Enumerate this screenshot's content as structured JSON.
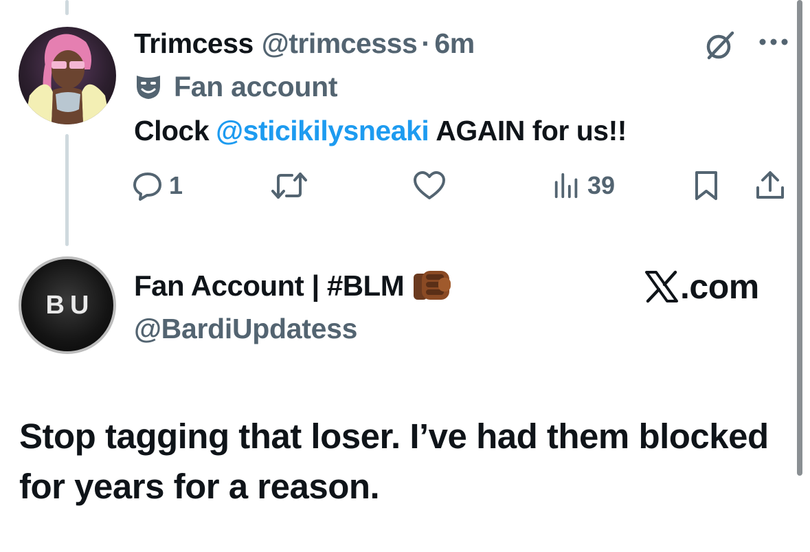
{
  "reply_tweet": {
    "author_name": "Trimcess",
    "author_handle": "@trimcesss",
    "separator": "·",
    "time": "6m",
    "label": "Fan account",
    "label_icon": "theater-mask-icon",
    "text_before": "Clock",
    "mention": "@sticikilysneaki",
    "text_after": "AGAIN for us!!",
    "mention_color": "#1d9bf0",
    "actions": {
      "reply_count": "1",
      "retweet_count": "",
      "like_count": "",
      "views_count": "39"
    }
  },
  "quoted_tweet": {
    "avatar_text": "BU",
    "author_name": "Fan Account | #BLM",
    "emoji": "oncoming-fist-icon",
    "author_handle": "@BardiUpdatess",
    "site_label": ".com",
    "body": "Stop tagging that loser. I’ve had them blocked for years for a reason."
  },
  "colors": {
    "text_primary": "#0f1419",
    "text_secondary": "#536471",
    "thread_line": "#cfd9de"
  }
}
